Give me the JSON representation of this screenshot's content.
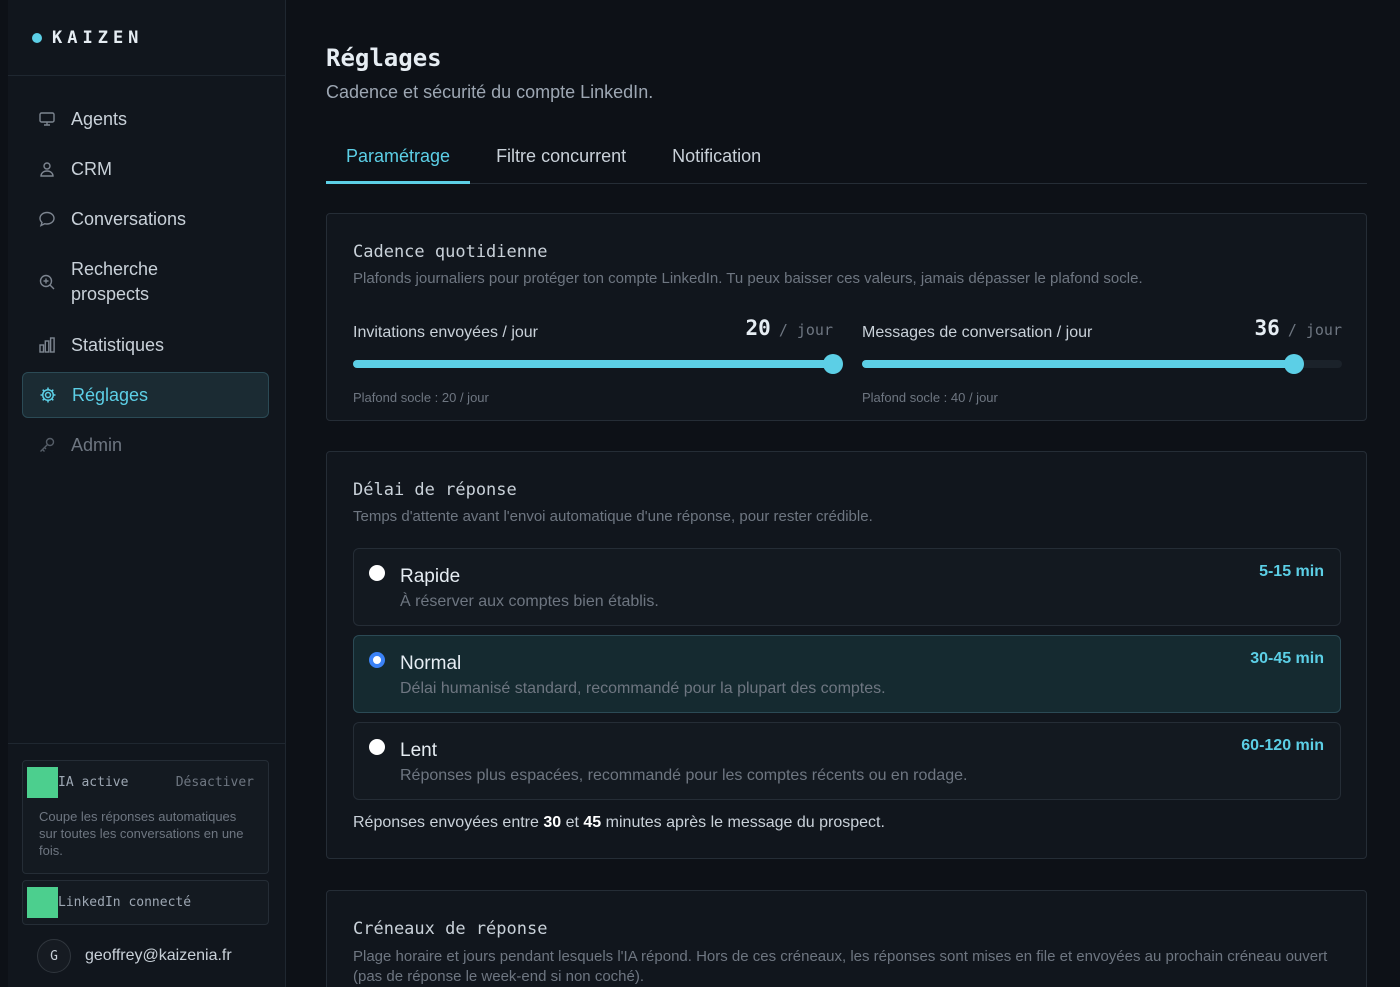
{
  "brand": {
    "name": "KAIZEN"
  },
  "sidebar": {
    "items": [
      {
        "label": "Agents",
        "icon": "monitor-icon"
      },
      {
        "label": "CRM",
        "icon": "users-icon"
      },
      {
        "label": "Conversations",
        "icon": "chat-bubble-icon"
      },
      {
        "label": "Recherche prospects",
        "icon": "search-plus-icon"
      },
      {
        "label": "Statistiques",
        "icon": "bar-chart-icon"
      },
      {
        "label": "Réglages",
        "icon": "gear-icon",
        "active": true
      },
      {
        "label": "Admin",
        "icon": "key-icon"
      }
    ],
    "ia": {
      "label": "IA active",
      "toggle": "Désactiver",
      "description": "Coupe les réponses automatiques sur toutes les conversations en une fois."
    },
    "linkedin": {
      "label": "LinkedIn connecté"
    },
    "user": {
      "initial": "G",
      "email": "geoffrey@kaizenia.fr"
    }
  },
  "page": {
    "title": "Réglages",
    "subtitle": "Cadence et sécurité du compte LinkedIn."
  },
  "tabs": [
    {
      "label": "Paramétrage",
      "active": true
    },
    {
      "label": "Filtre concurrent"
    },
    {
      "label": "Notification"
    }
  ],
  "cadence": {
    "title": "Cadence quotidienne",
    "subtitle": "Plafonds journaliers pour protéger ton compte LinkedIn. Tu peux baisser ces valeurs, jamais dépasser le plafond socle.",
    "invitations": {
      "label": "Invitations envoyées / jour",
      "value": "20",
      "unit": "/ jour",
      "note": "Plafond socle : 20 / jour",
      "fraction": 1.0
    },
    "messages": {
      "label": "Messages de conversation / jour",
      "value": "36",
      "unit": "/ jour",
      "note": "Plafond socle : 40 / jour",
      "fraction": 0.9
    }
  },
  "delai": {
    "title": "Délai de réponse",
    "subtitle": "Temps d'attente avant l'envoi automatique d'une réponse, pour rester crédible.",
    "options": [
      {
        "title": "Rapide",
        "description": "À réserver aux comptes bien établis.",
        "range": "5-15 min",
        "selected": false
      },
      {
        "title": "Normal",
        "description": "Délai humanisé standard, recommandé pour la plupart des comptes.",
        "range": "30-45 min",
        "selected": true
      },
      {
        "title": "Lent",
        "description": "Réponses plus espacées, recommandé pour les comptes récents ou en rodage.",
        "range": "60-120 min",
        "selected": false
      }
    ],
    "summary": {
      "prefix": "Réponses envoyées entre",
      "min": "30",
      "middle": "et",
      "max": "45",
      "suffix": "minutes après le message du prospect."
    }
  },
  "creneaux": {
    "title": "Créneaux de réponse",
    "subtitle": "Plage horaire et jours pendant lesquels l'IA répond. Hors de ces créneaux, les réponses sont mises en file et envoyées au prochain créneau ouvert (pas de réponse le week-end si non coché)."
  },
  "colors": {
    "accent": "#5ccfe6",
    "green": "#4ccf8e",
    "radio": "#3b82f6",
    "bg": "#0d1117"
  }
}
